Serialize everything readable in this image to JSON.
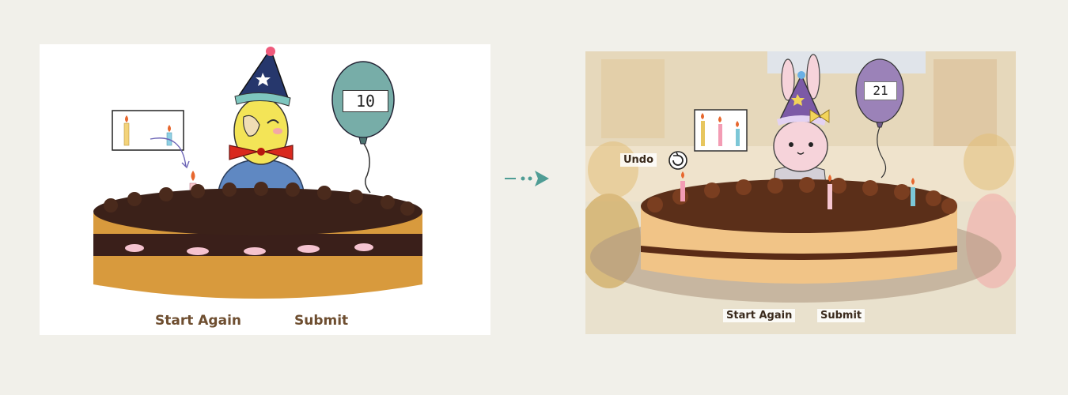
{
  "left_scene": {
    "balloon_number": "10",
    "start_again_label": "Start Again",
    "submit_label": "Submit"
  },
  "right_scene": {
    "balloon_number": "21",
    "undo_label": "Undo",
    "start_again_label": "Start Again",
    "submit_label": "Submit"
  },
  "icons": {
    "transition_arrow": "dotted-arrow-right-icon",
    "undo": "undo-icon"
  }
}
